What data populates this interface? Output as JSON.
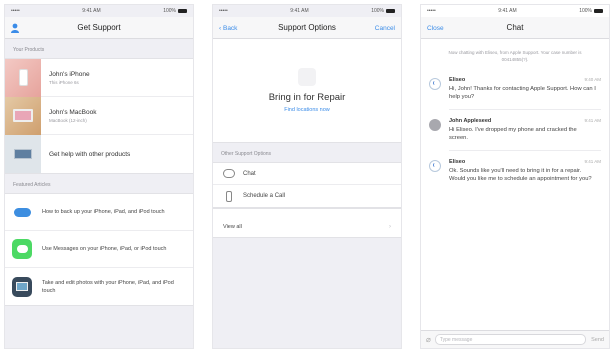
{
  "status": {
    "carrier": "•••••",
    "time": "9:41 AM",
    "battery": "100%"
  },
  "support": {
    "title": "Get Support",
    "products_label": "Your Products",
    "products": [
      {
        "name": "John's iPhone",
        "sub": "This iPhone 6s"
      },
      {
        "name": "John's MacBook",
        "sub": "MacBook (12-inch)"
      },
      {
        "name": "Get help with other products",
        "sub": ""
      }
    ],
    "articles_label": "Featured Articles",
    "articles": [
      {
        "text": "How to back up your iPhone, iPad, and iPod touch",
        "icon": "icloud-icon"
      },
      {
        "text": "Use Messages on your iPhone, iPad, or iPod touch",
        "icon": "messages-icon"
      },
      {
        "text": "Take and edit photos with your iPhone, iPad, and iPod touch",
        "icon": "photos-icon"
      }
    ]
  },
  "options": {
    "back_label": "Back",
    "title": "Support Options",
    "cancel_label": "Cancel",
    "repair_title": "Bring in for Repair",
    "repair_link": "Find locations now",
    "other_label": "Other Support Options",
    "items": [
      {
        "label": "Chat",
        "icon": "chat-bubble-icon"
      },
      {
        "label": "Schedule a Call",
        "icon": "phone-icon"
      }
    ],
    "view_all": "View all"
  },
  "chat": {
    "close_label": "Close",
    "title": "Chat",
    "note": "Now chatting with Eliseo, from Apple Support. Your case number is 00414855(?).",
    "messages": [
      {
        "name": "Eliseo",
        "time": "9:40 AM",
        "text": "Hi, John! Thanks for contacting Apple Support. How can I help you?",
        "role": "agent"
      },
      {
        "name": "John Appleseed",
        "time": "9:41 AM",
        "text": "Hi Eliseo. I've dropped my phone and cracked the screen.",
        "role": "user"
      },
      {
        "name": "Eliseo",
        "time": "9:41 AM",
        "text": "Ok. Sounds like you'll need to bring it in for a repair. Would you like me to schedule an appointment for you?",
        "role": "agent"
      }
    ],
    "input_placeholder": "Type message",
    "send_label": "Send"
  }
}
